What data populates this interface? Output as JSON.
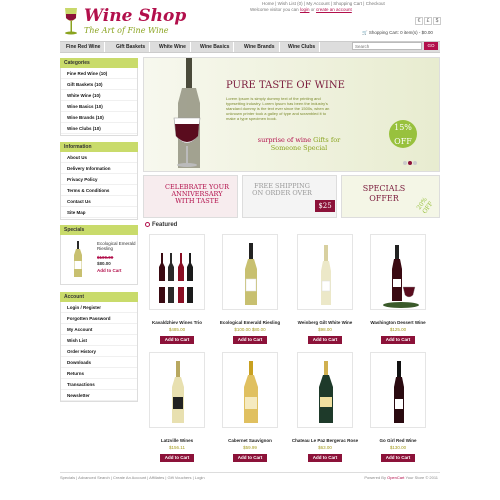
{
  "header": {
    "logo_title": "Wine Shop",
    "logo_sub": "The Art of Fine Wine",
    "welcome_prefix": "Welcome visitor you can",
    "login": "login",
    "or": "or",
    "create_account": "create an account",
    "toplinks": "Home | Wish List (0) | My Account | Shopping Cart | Checkout",
    "currencies": [
      "€",
      "£",
      "$"
    ]
  },
  "nav": {
    "items": [
      "Fine Red Wine",
      "Gift Baskets",
      "White Wine",
      "Wine Basics",
      "Wine Brands",
      "Wine Clubs"
    ]
  },
  "cart": {
    "text": "Shopping Cart: 0 item(s) - $0.00"
  },
  "search": {
    "placeholder": "Search",
    "go": "GO"
  },
  "sidebar": {
    "categories_title": "Categories",
    "categories": [
      "Fine Red Wine (10)",
      "Gift Baskets (10)",
      "White Wine (10)",
      "Wine Basics (10)",
      "Wine Brands (10)",
      "Wine Clubs (10)"
    ],
    "information_title": "Information",
    "information": [
      "About Us",
      "Delivery Information",
      "Privacy Policy",
      "Terms & Conditions",
      "Contact Us",
      "Site Map"
    ],
    "specials_title": "Specials",
    "special": {
      "name": "Ecological Emerald Riesling",
      "old_price": "$100.00",
      "new_price": "$80.00",
      "add": "Add to Cart"
    },
    "account_title": "Account",
    "account": [
      "Login / Register",
      "Forgotten Password",
      "My Account",
      "Wish List",
      "Order History",
      "Downloads",
      "Returns",
      "Transactions",
      "Newsletter"
    ]
  },
  "banner": {
    "title": "PURE TASTE OF WINE",
    "text": "Lorem Ipsum is simply dummy text of the printing and typesetting industry. Lorem Ipsum has been the industry's standard dummy is the text ever since the 1500s, when an unknown printer took a galley of type and scrambled it to make a type specimen book.",
    "sub_1": "surprise of wine",
    "sub_2": "Gifts for",
    "sub_3": "Someone Special",
    "badge_pct": "15%",
    "badge_off": "OFF"
  },
  "promos": {
    "anniversary": "CELEBRATE YOUR ANNIVERSARY WITH TASTE",
    "shipping": "FREE SHIPPING ON ORDER OVER",
    "shipping_amount": "$25",
    "specials": "SPECIALS OFFER",
    "specials_badge": "20% OFF"
  },
  "featured": {
    "title": "Featured",
    "add": "Add to Cart",
    "products": [
      {
        "name": "Kavaldzhiev Wines Trio",
        "price": "$485.00"
      },
      {
        "name": "Ecological Emerald Riesling",
        "price": "$100.00 $80.00"
      },
      {
        "name": "Weinberg Gilt White Wine",
        "price": "$98.00"
      },
      {
        "name": "Washington Dessert Wine",
        "price": "$125.00"
      },
      {
        "name": "Latzville Wines",
        "price": "$156.11"
      },
      {
        "name": "Cabernet Sauvignon",
        "price": "$59.99"
      },
      {
        "name": "Chateau Le Paz Bergerac Rose",
        "price": "$63.00"
      },
      {
        "name": "Go Girl Red Wine",
        "price": "$130.00"
      }
    ]
  },
  "footer": {
    "links": "Specials | Advanced Search | Create An Account | Affiliates | Gift Vouchers | Login",
    "powered_prefix": "Powered By",
    "powered_link": "OpenCart",
    "powered_suffix": "Your Store © 2011"
  }
}
